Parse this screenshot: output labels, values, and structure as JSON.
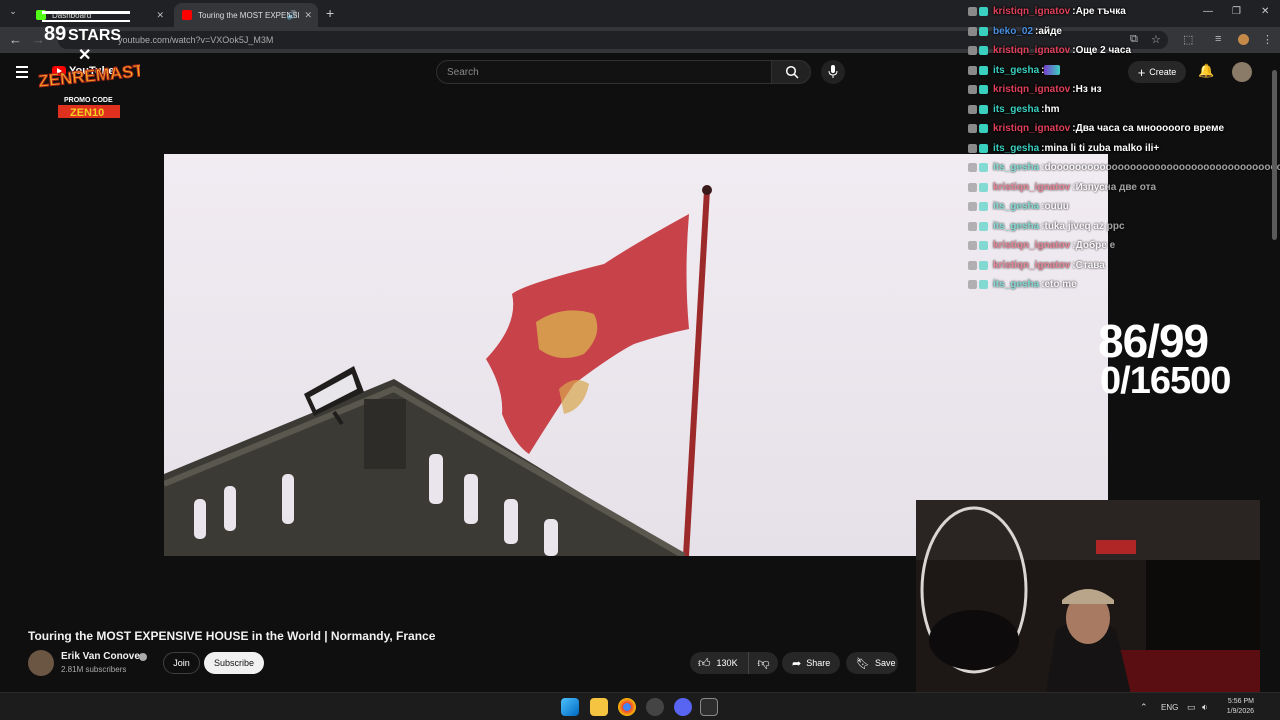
{
  "browser": {
    "tabs": [
      {
        "label": "Dashboard",
        "active": false
      },
      {
        "label": "Touring the MOST EXPENSI",
        "active": true
      }
    ],
    "url": "youtube.com/watch?v=VXOok5J_M3M",
    "new_tab_symbol": "+",
    "tab_close_symbol": "✕"
  },
  "youtube": {
    "logo_text": "YouTube",
    "search_placeholder": "Search",
    "create_label": "Create"
  },
  "overlays": {
    "stars_text": "89STARS",
    "zen_text": "ZENREMASTA",
    "promo_label": "PROMO CODE",
    "promo_code": "ZEN10",
    "counter_top": "86/99",
    "counter_bottom": "0/16500"
  },
  "chat": [
    {
      "user": "kristiqn_ignatov",
      "color": "#e0405a",
      "message": "Аре тъчка",
      "faded": false
    },
    {
      "user": "beko_02",
      "color": "#4a90e2",
      "message": "айде",
      "faded": false
    },
    {
      "user": "kristiqn_ignatov",
      "color": "#e0405a",
      "message": "Още 2 часа",
      "faded": false
    },
    {
      "user": "its_gesha",
      "color": "#3ad0c0",
      "message": "",
      "faded": false
    },
    {
      "user": "kristiqn_ignatov",
      "color": "#e0405a",
      "message": "Нз нз",
      "faded": false
    },
    {
      "user": "its_gesha",
      "color": "#3ad0c0",
      "message": "hm",
      "faded": false
    },
    {
      "user": "kristiqn_ignatov",
      "color": "#e0405a",
      "message": "Два часа са мнооооого време",
      "faded": false
    },
    {
      "user": "its_gesha",
      "color": "#3ad0c0",
      "message": "mina li ti zuba malko ili+",
      "faded": false
    },
    {
      "user": "its_gesha",
      "color": "#3ad0c0",
      "message": "dooooooooooooooooooooooooooooooooooooooooooo",
      "faded": true
    },
    {
      "user": "kristiqn_ignatov",
      "color": "#e0405a",
      "message": "Изпусна две ота",
      "faded": true
    },
    {
      "user": "its_gesha",
      "color": "#3ad0c0",
      "message": "ouuu",
      "faded": true
    },
    {
      "user": "its_gesha",
      "color": "#3ad0c0",
      "message": "tuka jiveq az ppc",
      "faded": true
    },
    {
      "user": "kristiqn_ignatov",
      "color": "#e0405a",
      "message": "Добре е",
      "faded": true
    },
    {
      "user": "kristiqn_ignatov",
      "color": "#e0405a",
      "message": "Става",
      "faded": true
    },
    {
      "user": "its_gesha",
      "color": "#3ad0c0",
      "message": "eto me",
      "faded": true
    }
  ],
  "video": {
    "title": "Touring the MOST EXPENSIVE HOUSE in the World | Normandy, France",
    "channel": "Erik Van Conover",
    "subscribers": "2.81M subscribers",
    "join_label": "Join",
    "subscribe_label": "Subscribe",
    "likes": "130K",
    "share_label": "Share",
    "save_label": "Save"
  },
  "taskbar": {
    "language": "ENG",
    "time": "5:56 PM",
    "date": "1/9/2026",
    "apps": [
      "windows-start",
      "file-explorer",
      "chrome",
      "obs",
      "discord",
      "terminal"
    ]
  },
  "colors": {
    "youtube_red": "#ff0000",
    "chat_red": "#e0405a",
    "chat_teal": "#3ad0c0",
    "chat_blue": "#4a90e2"
  }
}
